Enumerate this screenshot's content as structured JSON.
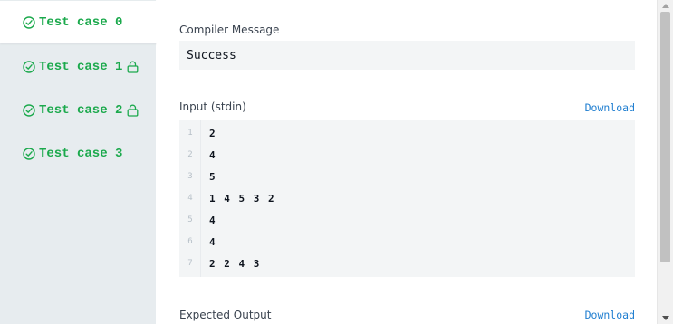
{
  "test_cases": [
    {
      "label": "Test case 0",
      "status": "passed",
      "locked": false,
      "active": true
    },
    {
      "label": "Test case 1",
      "status": "passed",
      "locked": true,
      "active": false
    },
    {
      "label": "Test case 2",
      "status": "passed",
      "locked": true,
      "active": false
    },
    {
      "label": "Test case 3",
      "status": "passed",
      "locked": false,
      "active": false
    }
  ],
  "compiler_message": {
    "label": "Compiler Message",
    "value": "Success"
  },
  "input": {
    "label": "Input (stdin)",
    "download_label": "Download",
    "lines": [
      {
        "num": "1",
        "text": "2"
      },
      {
        "num": "2",
        "text": "4"
      },
      {
        "num": "3",
        "text": "5"
      },
      {
        "num": "4",
        "text": "1 4 5 3 2"
      },
      {
        "num": "5",
        "text": "4"
      },
      {
        "num": "6",
        "text": "4"
      },
      {
        "num": "7",
        "text": "2 2 4 3"
      }
    ]
  },
  "expected_output": {
    "label": "Expected Output",
    "download_label": "Download"
  },
  "icons": {
    "passed": "check-circle-icon",
    "locked": "lock-icon"
  },
  "colors": {
    "success": "#1ba94c",
    "link": "#1f7ed0",
    "sidebar_bg": "#e7ecef",
    "code_bg": "#f3f5f6"
  }
}
